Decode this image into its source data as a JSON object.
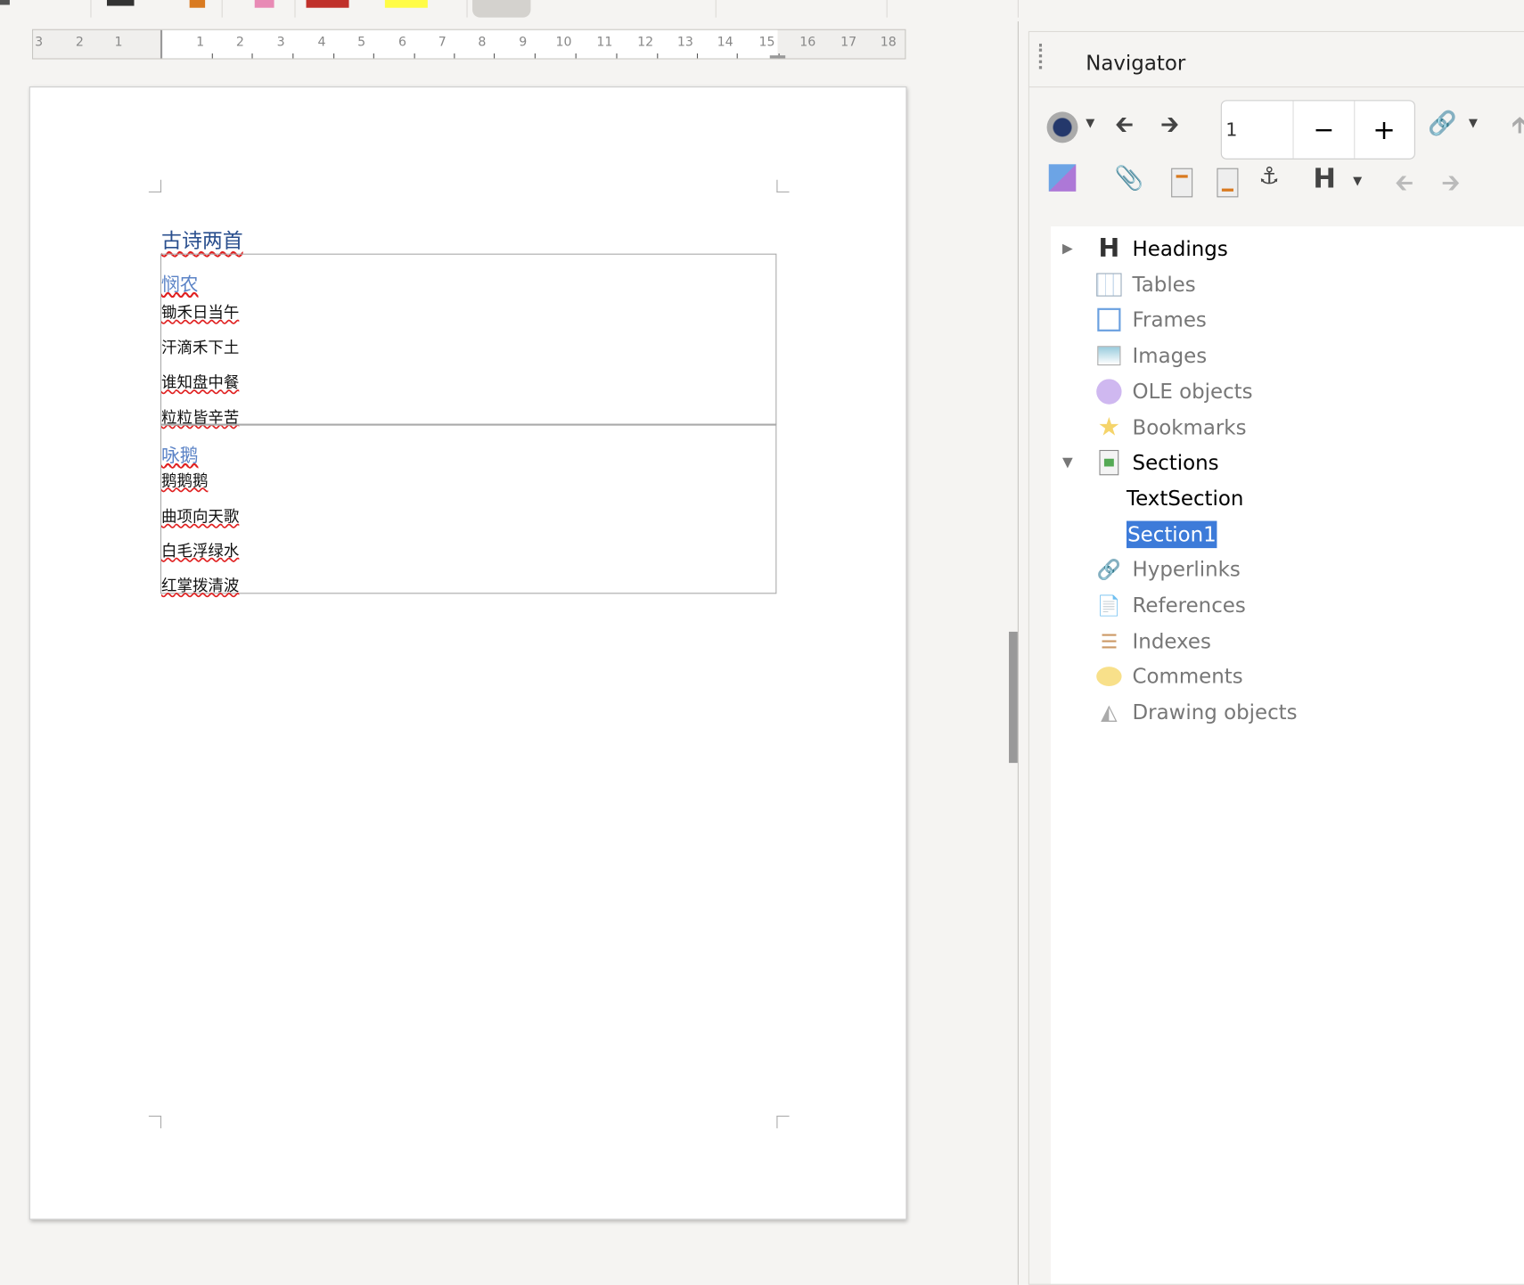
{
  "ruler": {
    "labels": [
      "3",
      "2",
      "1",
      "1",
      "2",
      "3",
      "4",
      "5",
      "6",
      "7",
      "8",
      "9",
      "10",
      "11",
      "12",
      "13",
      "14",
      "15",
      "16",
      "17",
      "18"
    ]
  },
  "document": {
    "title": "古诗两首",
    "sections": [
      {
        "heading": "悯农",
        "lines": [
          "锄禾日当午",
          "汗滴禾下土",
          "谁知盘中餐",
          "粒粒皆辛苦"
        ]
      },
      {
        "heading": "咏鹅",
        "lines": [
          "鹅鹅鹅",
          "曲项向天歌",
          "白毛浮绿水",
          "红掌拨清波"
        ]
      }
    ]
  },
  "navigator": {
    "title": "Navigator",
    "page_value": "1",
    "minus": "−",
    "plus": "+",
    "items": [
      {
        "label": "Headings",
        "icon": "heading-icon",
        "expander": "collapsed",
        "dim": false
      },
      {
        "label": "Tables",
        "icon": "table-icon",
        "dim": true
      },
      {
        "label": "Frames",
        "icon": "frame-icon",
        "dim": true
      },
      {
        "label": "Images",
        "icon": "image-icon",
        "dim": true
      },
      {
        "label": "OLE objects",
        "icon": "ole-object-icon",
        "dim": true
      },
      {
        "label": "Bookmarks",
        "icon": "bookmark-star-icon",
        "dim": true
      },
      {
        "label": "Sections",
        "icon": "section-icon",
        "expander": "expanded",
        "dim": false
      },
      {
        "label": "TextSection",
        "child": true
      },
      {
        "label": "Section1",
        "child": true,
        "selected": true
      },
      {
        "label": "Hyperlinks",
        "icon": "hyperlink-icon",
        "dim": true
      },
      {
        "label": "References",
        "icon": "reference-icon",
        "dim": true
      },
      {
        "label": "Indexes",
        "icon": "index-icon",
        "dim": true
      },
      {
        "label": "Comments",
        "icon": "comment-icon",
        "dim": true
      },
      {
        "label": "Drawing objects",
        "icon": "drawing-object-icon",
        "dim": true
      }
    ]
  },
  "colors": {
    "selection": "#3d7bd9",
    "heading_text": "#2a4f8e",
    "subheading_text": "#5b83c6",
    "spellcheck": "#e02020"
  }
}
